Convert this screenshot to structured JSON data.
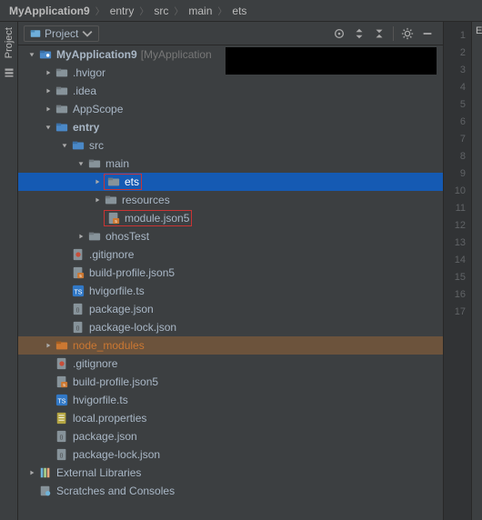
{
  "breadcrumb": {
    "items": [
      "MyApplication9",
      "entry",
      "src",
      "main",
      "ets"
    ]
  },
  "panel": {
    "title": "Project"
  },
  "editor": {
    "tab_hint": "En"
  },
  "lines": [
    "1",
    "2",
    "3",
    "4",
    "5",
    "6",
    "7",
    "8",
    "9",
    "10",
    "11",
    "12",
    "13",
    "14",
    "15",
    "16",
    "17"
  ],
  "tree": [
    {
      "depth": 0,
      "arrow": "down",
      "icon": "project",
      "label": "MyApplication9",
      "bold": true,
      "extra": "[MyApplication",
      "name": "root"
    },
    {
      "depth": 1,
      "arrow": "right",
      "icon": "folder",
      "label": ".hvigor",
      "name": "hvigor"
    },
    {
      "depth": 1,
      "arrow": "right",
      "icon": "folder",
      "label": ".idea",
      "name": "idea"
    },
    {
      "depth": 1,
      "arrow": "right",
      "icon": "folder",
      "label": "AppScope",
      "name": "appscope"
    },
    {
      "depth": 1,
      "arrow": "down",
      "icon": "module",
      "label": "entry",
      "bold": true,
      "name": "entry"
    },
    {
      "depth": 2,
      "arrow": "down",
      "icon": "module",
      "label": "src",
      "name": "src"
    },
    {
      "depth": 3,
      "arrow": "down",
      "icon": "folder",
      "label": "main",
      "name": "main"
    },
    {
      "depth": 4,
      "arrow": "right",
      "icon": "folder",
      "label": "ets",
      "selected": true,
      "redbox": true,
      "name": "ets"
    },
    {
      "depth": 4,
      "arrow": "right",
      "icon": "folder",
      "label": "resources",
      "name": "resources"
    },
    {
      "depth": 4,
      "arrow": "none",
      "icon": "json5",
      "label": "module.json5",
      "redbox": true,
      "name": "module-json5"
    },
    {
      "depth": 3,
      "arrow": "right",
      "icon": "folder",
      "label": "ohosTest",
      "name": "ohostest"
    },
    {
      "depth": 2,
      "arrow": "none",
      "icon": "gitignore",
      "label": ".gitignore",
      "name": "gitignore-entry"
    },
    {
      "depth": 2,
      "arrow": "none",
      "icon": "json5",
      "label": "build-profile.json5",
      "name": "build-profile-entry"
    },
    {
      "depth": 2,
      "arrow": "none",
      "icon": "ts",
      "label": "hvigorfile.ts",
      "name": "hvigorfile-entry"
    },
    {
      "depth": 2,
      "arrow": "none",
      "icon": "json",
      "label": "package.json",
      "name": "package-entry"
    },
    {
      "depth": 2,
      "arrow": "none",
      "icon": "json",
      "label": "package-lock.json",
      "name": "package-lock-entry"
    },
    {
      "depth": 1,
      "arrow": "right",
      "icon": "folder-lib",
      "label": "node_modules",
      "highlight": "brown",
      "orange": true,
      "name": "node-modules"
    },
    {
      "depth": 1,
      "arrow": "none",
      "icon": "gitignore",
      "label": ".gitignore",
      "name": "gitignore-root"
    },
    {
      "depth": 1,
      "arrow": "none",
      "icon": "json5",
      "label": "build-profile.json5",
      "name": "build-profile-root"
    },
    {
      "depth": 1,
      "arrow": "none",
      "icon": "ts",
      "label": "hvigorfile.ts",
      "name": "hvigorfile-root"
    },
    {
      "depth": 1,
      "arrow": "none",
      "icon": "props",
      "label": "local.properties",
      "name": "local-properties"
    },
    {
      "depth": 1,
      "arrow": "none",
      "icon": "json",
      "label": "package.json",
      "name": "package-root"
    },
    {
      "depth": 1,
      "arrow": "none",
      "icon": "json",
      "label": "package-lock.json",
      "name": "package-lock-root"
    },
    {
      "depth": 0,
      "arrow": "right",
      "icon": "libraries",
      "label": "External Libraries",
      "name": "external-libraries"
    },
    {
      "depth": 0,
      "arrow": "none",
      "icon": "scratches",
      "label": "Scratches and Consoles",
      "name": "scratches"
    }
  ]
}
